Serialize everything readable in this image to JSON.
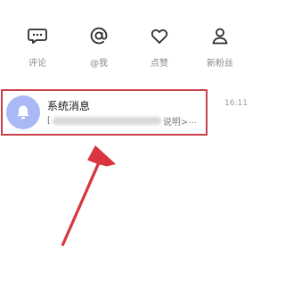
{
  "quick_actions": [
    {
      "label": "评论",
      "icon": "comment-icon"
    },
    {
      "label": "@我",
      "icon": "at-icon"
    },
    {
      "label": "点赞",
      "icon": "heart-icon"
    },
    {
      "label": "新粉丝",
      "icon": "user-icon"
    }
  ],
  "message": {
    "title": "系统消息",
    "preview_start": "[",
    "preview_end": "说明>",
    "preview_ellipsis": "...",
    "time": "16:11",
    "avatar_icon": "bell-icon"
  },
  "annotation": {
    "color": "#c9414b",
    "arrow_icon": "arrow-icon"
  },
  "colors": {
    "icon": "#2b2b2b",
    "avatar": "#aab8f6"
  }
}
